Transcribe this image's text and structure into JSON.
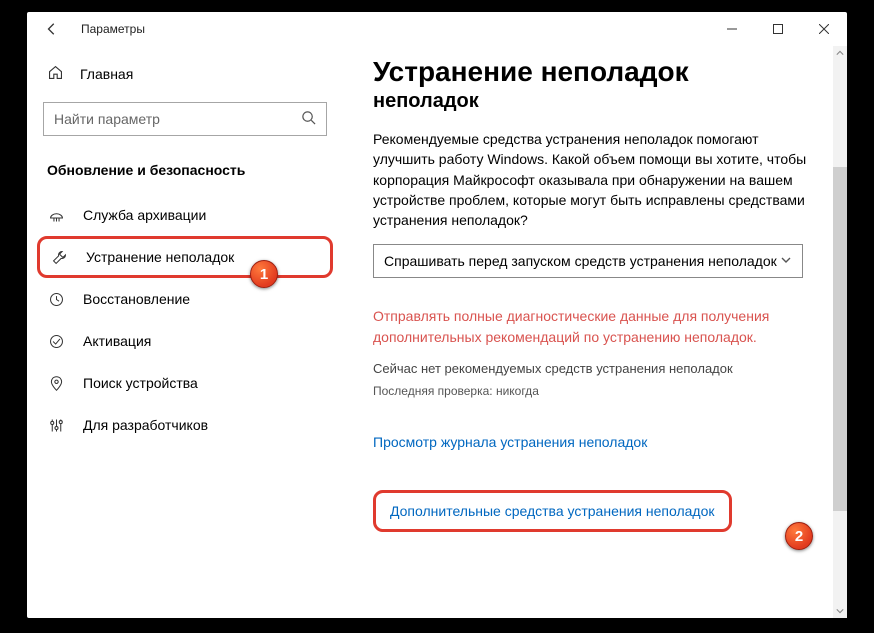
{
  "app_title": "Параметры",
  "sidebar": {
    "home": "Главная",
    "search_placeholder": "Найти параметр",
    "category": "Обновление и безопасность",
    "items": [
      {
        "label": "Служба архивации"
      },
      {
        "label": "Устранение неполадок"
      },
      {
        "label": "Восстановление"
      },
      {
        "label": "Активация"
      },
      {
        "label": "Поиск устройства"
      },
      {
        "label": "Для разработчиков"
      }
    ]
  },
  "content": {
    "h1": "Устранение неполадок",
    "h2": "неполадок",
    "para": "Рекомендуемые средства устранения неполадок помогают улучшить работу Windows. Какой объем помощи вы хотите, чтобы корпорация Майкрософт оказывала при обнаружении на вашем устройстве проблем, которые могут быть исправлены средствами устранения неполадок?",
    "select_value": "Спрашивать перед запуском средств устранения неполадок",
    "warn": "Отправлять полные диагностические данные для получения дополнительных рекомендаций по устранению неполадок.",
    "status": "Сейчас нет рекомендуемых средств устранения неполадок",
    "last_check": "Последняя проверка: никогда",
    "link_history": "Просмотр журнала устранения неполадок",
    "link_more": "Дополнительные средства устранения неполадок"
  },
  "callouts": {
    "c1": "1",
    "c2": "2"
  }
}
